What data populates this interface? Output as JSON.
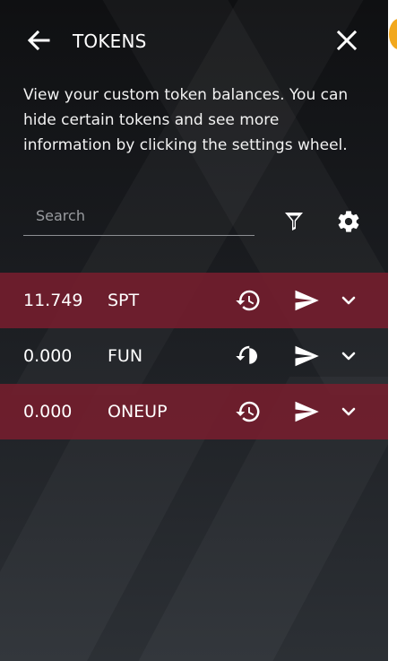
{
  "header": {
    "title": "TOKENS",
    "back_icon": "arrow-left-icon",
    "close_icon": "close-icon"
  },
  "description": "View your custom token balances. You can hide certain tokens and see more information by clicking the settings wheel.",
  "search": {
    "placeholder": "Search",
    "value": ""
  },
  "toolbar": {
    "filter_icon": "filter-icon",
    "settings_icon": "gear-icon"
  },
  "tokens": [
    {
      "balance": "11.749",
      "symbol": "SPT",
      "highlighted": true
    },
    {
      "balance": "0.000",
      "symbol": "FUN",
      "highlighted": false
    },
    {
      "balance": "0.000",
      "symbol": "ONEUP",
      "highlighted": true
    }
  ],
  "row_icons": {
    "history": "history-icon",
    "send": "send-icon",
    "expand": "chevron-down-icon"
  },
  "colors": {
    "row_highlight": "#761e2e",
    "panel_background": "#1b1d21",
    "text": "#ffffff"
  }
}
